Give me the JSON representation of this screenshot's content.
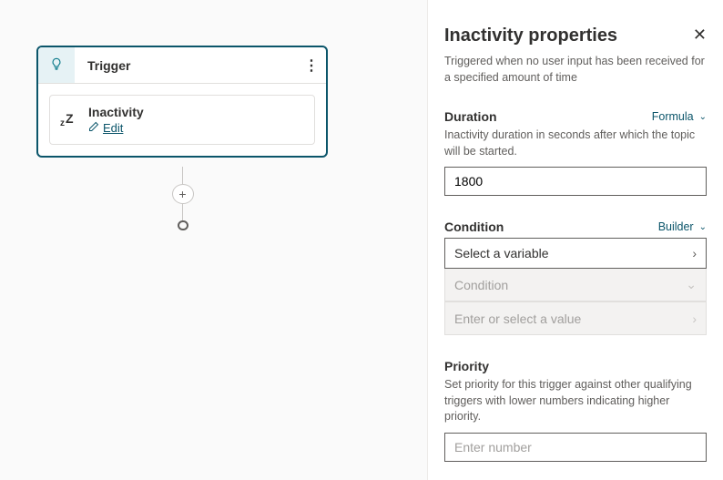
{
  "canvas": {
    "trigger_node": {
      "title": "Trigger",
      "card": {
        "title": "Inactivity",
        "edit_label": "Edit"
      }
    }
  },
  "panel": {
    "title": "Inactivity properties",
    "description": "Triggered when no user input has been received for a specified amount of time",
    "duration": {
      "label": "Duration",
      "mode": "Formula",
      "help": "Inactivity duration in seconds after which the topic will be started.",
      "value": "1800"
    },
    "condition": {
      "label": "Condition",
      "mode": "Builder",
      "variable_placeholder": "Select a variable",
      "operator_placeholder": "Condition",
      "value_placeholder": "Enter or select a value"
    },
    "priority": {
      "label": "Priority",
      "help": "Set priority for this trigger against other qualifying triggers with lower numbers indicating higher priority.",
      "placeholder": "Enter number"
    }
  }
}
